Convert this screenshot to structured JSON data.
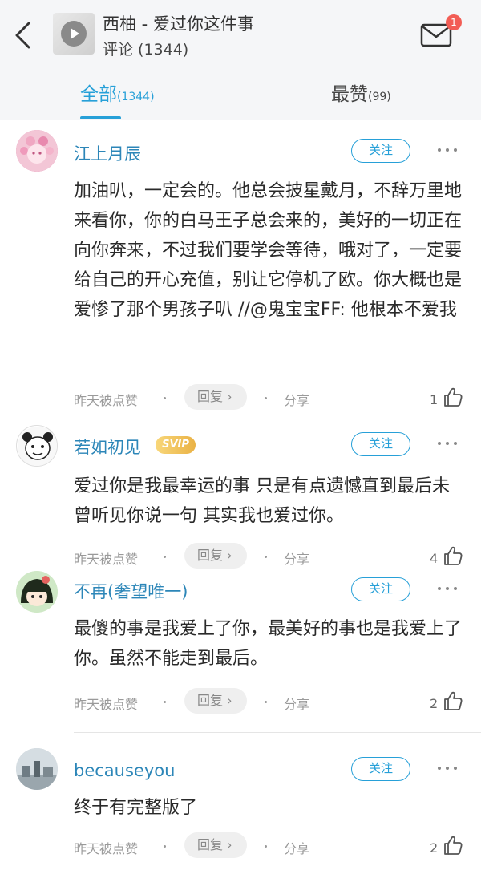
{
  "header": {
    "song_title": "西柚 - 爱过你这件事",
    "comments_title": "评论 (1344)",
    "mail_badge": "1"
  },
  "tabs": [
    {
      "label": "全部",
      "count": "(1344)",
      "active": true
    },
    {
      "label": "最赞",
      "count": "(99)",
      "active": false
    }
  ],
  "comments": [
    {
      "username": "江上月辰",
      "follow_label": "关注",
      "content": "加油叭，一定会的。他总会披星戴月，不辞万里地来看你，你的白马王子总会来的，美好的一切正在向你奔来，不过我们要学会等待，哦对了，一定要给自己的开心充值，别让它停机了欧。你大概也是爱惨了那个男孩子叭 //@鬼宝宝FF: 他根本不爱我",
      "time": "昨天被点赞",
      "reply_label": "回复 ›",
      "share_label": "分享",
      "likes": "1"
    },
    {
      "username": "若如初见",
      "badge": "SVIP",
      "follow_label": "关注",
      "content": "爱过你是我最幸运的事 只是有点遗憾直到最后未曾听见你说一句 其实我也爱过你。",
      "time": "昨天被点赞",
      "reply_label": "回复 ›",
      "share_label": "分享",
      "likes": "4"
    },
    {
      "username": "不再(奢望唯一)",
      "follow_label": "关注",
      "content": "最傻的事是我爱上了你，最美好的事也是我爱上了你。虽然不能走到最后。",
      "time": "昨天被点赞",
      "reply_label": "回复 ›",
      "share_label": "分享",
      "likes": "2"
    },
    {
      "username": "becauseyou",
      "follow_label": "关注",
      "content": "终于有完整版了",
      "time": "昨天被点赞",
      "reply_label": "回复 ›",
      "share_label": "分享",
      "likes": "2"
    }
  ],
  "colors": {
    "accent": "#27a0d8",
    "username": "#2c86b8",
    "badge_red": "#f25d55",
    "svip_gold": "#eab245"
  },
  "icons": [
    "back-arrow-icon",
    "play-icon",
    "mail-icon",
    "more-dots-icon",
    "thumbs-up-icon"
  ]
}
